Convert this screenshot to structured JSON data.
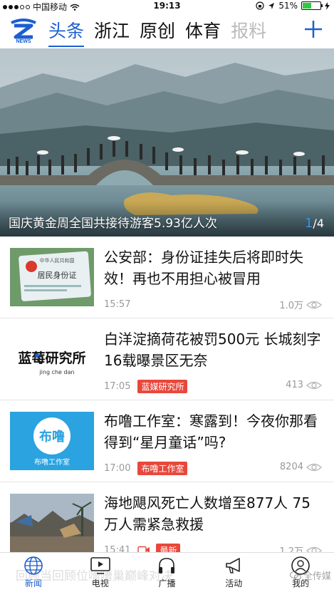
{
  "status_bar": {
    "carrier": "中国移动",
    "time": "19:13",
    "battery": "51%",
    "battery_level": 0.51
  },
  "header": {
    "logo_text": "NEWS",
    "tabs": [
      "头条",
      "浙江",
      "原创",
      "体育",
      "报料"
    ],
    "active_tab": 0
  },
  "hero": {
    "caption": "国庆黄金周全国共接待游客5.93亿人次",
    "page_current": "1",
    "page_total": "/4"
  },
  "news": [
    {
      "title": "公安部：身份证挂失后将即时失效！再也不用担心被冒用",
      "time": "15:57",
      "tag": "",
      "views": "1.0万",
      "thumb_text": "居民身份证",
      "thumb_header": "中华人民共和国"
    },
    {
      "title": "白洋淀摘荷花被罚500元 长城刻字16载曝景区无奈",
      "time": "17:05",
      "tag": "蓝媒研究所",
      "views": "413",
      "thumb_text": "蓝莓研究所",
      "thumb_sub": "jing che dan"
    },
    {
      "title": "布噜工作室：寒露到！今夜你那看得到“星月童话”吗?",
      "time": "17:00",
      "tag": "布噜工作室",
      "views": "8204",
      "thumb_text": "布噜",
      "thumb_sub": "布噜工作室"
    },
    {
      "title": "海地飓风死亡人数增至877人 75万人需紧急救援",
      "time": "15:41",
      "tag": "最新",
      "views": "1.2万",
      "thumb_text": ""
    }
  ],
  "bottom_nav": {
    "items": [
      "新闻",
      "电视",
      "广播",
      "活动",
      "我的"
    ],
    "active": 0
  },
  "overlay": {
    "watermark": "回顾当回顾位嘈嘈巢巅峰对决",
    "wechat_label": "全传媒"
  },
  "colors": {
    "accent": "#1b5fd0",
    "tag_red": "#e8483c",
    "meta_gray": "#999999"
  }
}
